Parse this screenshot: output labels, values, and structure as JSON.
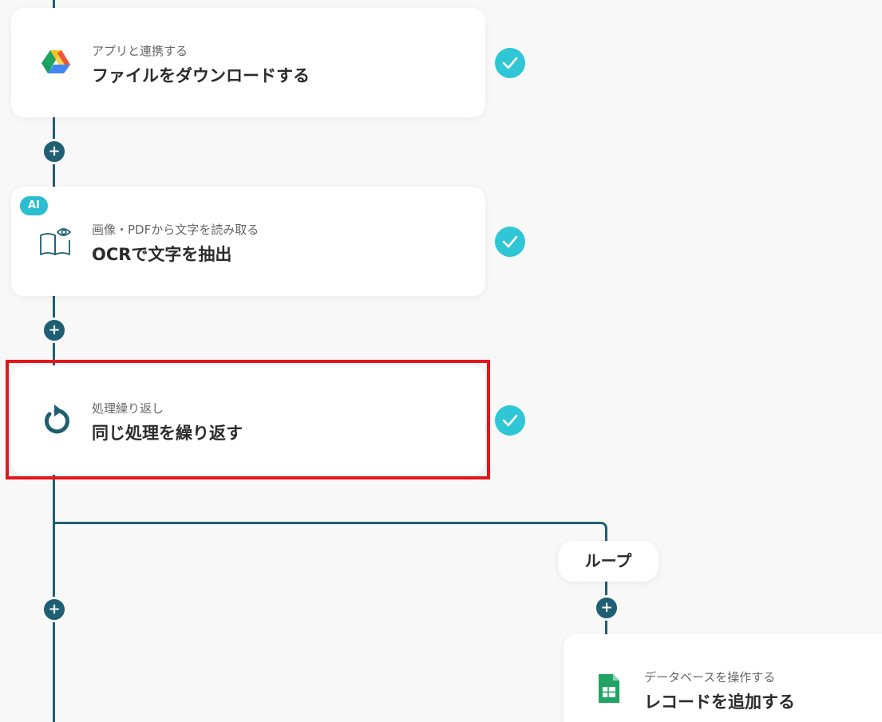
{
  "flow": {
    "steps": [
      {
        "subtitle": "アプリと連携する",
        "title": "ファイルをダウンロードする",
        "icon": "google-drive-icon",
        "status": "completed"
      },
      {
        "badge": "AI",
        "subtitle": "画像・PDFから文字を読み取る",
        "title": "OCRで文字を抽出",
        "icon": "book-eye-icon",
        "status": "completed"
      },
      {
        "subtitle": "処理繰り返し",
        "title": "同じ処理を繰り返す",
        "icon": "loop-arrow-icon",
        "status": "completed",
        "highlighted": true
      }
    ],
    "loop_label": "ループ",
    "loop_step": {
      "subtitle": "データベースを操作する",
      "title": "レコードを追加する",
      "icon": "google-sheets-icon"
    },
    "add_step_symbol": "+"
  },
  "colors": {
    "connector": "#1f5f73",
    "check": "#2fc6d6",
    "ai_badge": "#2bbdd0",
    "highlight": "#e4161b",
    "background": "#f8f8f8"
  }
}
